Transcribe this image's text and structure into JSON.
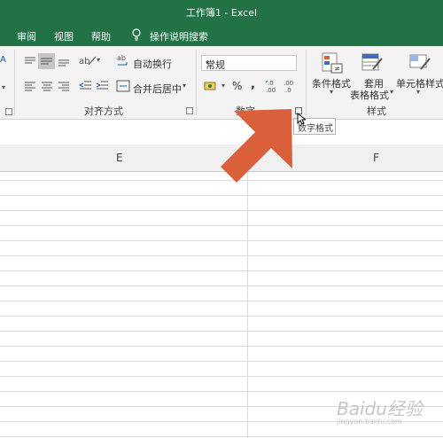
{
  "window": {
    "title": "工作簿1  -  Excel"
  },
  "tabs": [
    {
      "label": "审阅"
    },
    {
      "label": "视图"
    },
    {
      "label": "帮助"
    },
    {
      "label": "操作说明搜索"
    }
  ],
  "ribbon": {
    "alignment": {
      "wrap_text": "自动换行",
      "merge_center": "合并后居中",
      "group_label": "对齐方式"
    },
    "number": {
      "format_value": "常规",
      "percent": "%",
      "comma": ",",
      "group_label": "数字"
    },
    "styles": {
      "conditional_format": "条件格式",
      "table_format_line1": "套用",
      "table_format_line2": "表格格式",
      "cell_styles": "单元格样式",
      "group_label": "样式"
    }
  },
  "tooltip": {
    "text": "数字格式"
  },
  "columns": [
    {
      "label": "E"
    },
    {
      "label": "F"
    }
  ],
  "watermark": {
    "text": "Baidu经验",
    "sub": "jingyan.baidu.com"
  },
  "colors": {
    "titlebar": "#217346",
    "arrow": "#d9603b"
  }
}
